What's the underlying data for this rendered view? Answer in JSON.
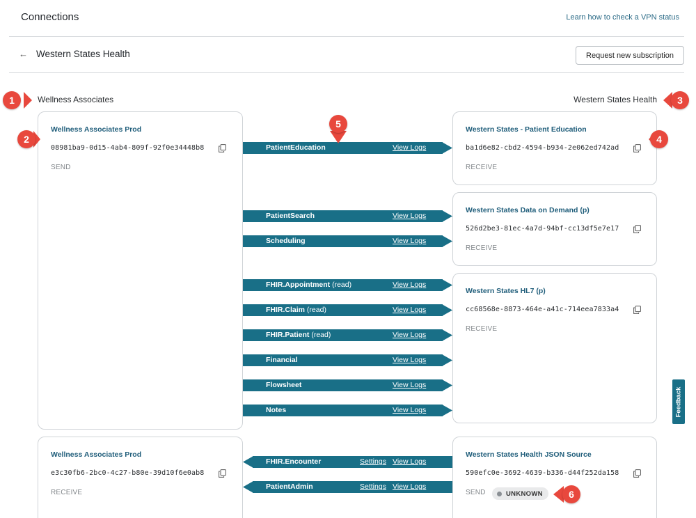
{
  "header": {
    "title": "Connections",
    "vpn_link": "Learn how to check a VPN status"
  },
  "subheader": {
    "back_icon": "arrow-left-icon",
    "title": "Western States Health",
    "request_button": "Request new subscription"
  },
  "left_org": "Wellness Associates",
  "right_org": "Western States Health",
  "left_cards": [
    {
      "title": "Wellness Associates Prod",
      "id": "08981ba9-0d15-4ab4-809f-92f0e34448b8",
      "direction": "SEND"
    },
    {
      "title": "Wellness Associates Prod",
      "id": "e3c30fb6-2bc0-4c27-b80e-39d10f6e0ab8",
      "direction": "RECEIVE"
    }
  ],
  "right_cards": [
    {
      "title": "Western States - Patient Education",
      "id": "ba1d6e82-cbd2-4594-b934-2e062ed742ad",
      "direction": "RECEIVE"
    },
    {
      "title": "Western States Data on Demand (p)",
      "id": "526d2be3-81ec-4a7d-94bf-cc13df5e7e17",
      "direction": "RECEIVE"
    },
    {
      "title": "Western States HL7 (p)",
      "id": "cc68568e-8873-464e-a41c-714eea7833a4",
      "direction": "RECEIVE"
    },
    {
      "title": "Western States Health JSON Source",
      "id": "590efc0e-3692-4639-b336-d44f252da158",
      "direction": "SEND",
      "status": "UNKNOWN"
    }
  ],
  "connections_out": [
    {
      "name": "PatientEducation",
      "suffix": "",
      "link": "View Logs"
    },
    {
      "name": "PatientSearch",
      "suffix": "",
      "link": "View Logs"
    },
    {
      "name": "Scheduling",
      "suffix": "",
      "link": "View Logs"
    },
    {
      "name": "FHIR.Appointment",
      "suffix": " (read)",
      "link": "View Logs"
    },
    {
      "name": "FHIR.Claim",
      "suffix": " (read)",
      "link": "View Logs"
    },
    {
      "name": "FHIR.Patient",
      "suffix": " (read)",
      "link": "View Logs"
    },
    {
      "name": "Financial",
      "suffix": "",
      "link": "View Logs"
    },
    {
      "name": "Flowsheet",
      "suffix": "",
      "link": "View Logs"
    },
    {
      "name": "Notes",
      "suffix": "",
      "link": "View Logs"
    }
  ],
  "connections_in": [
    {
      "name": "FHIR.Encounter",
      "settings": "Settings",
      "link": "View Logs"
    },
    {
      "name": "PatientAdmin",
      "settings": "Settings",
      "link": "View Logs"
    }
  ],
  "callouts": [
    "1",
    "2",
    "3",
    "4",
    "5",
    "6"
  ],
  "feedback": "Feedback",
  "colors": {
    "connector": "#196f87",
    "callout": "#e8483d",
    "link": "#2a6a86"
  }
}
